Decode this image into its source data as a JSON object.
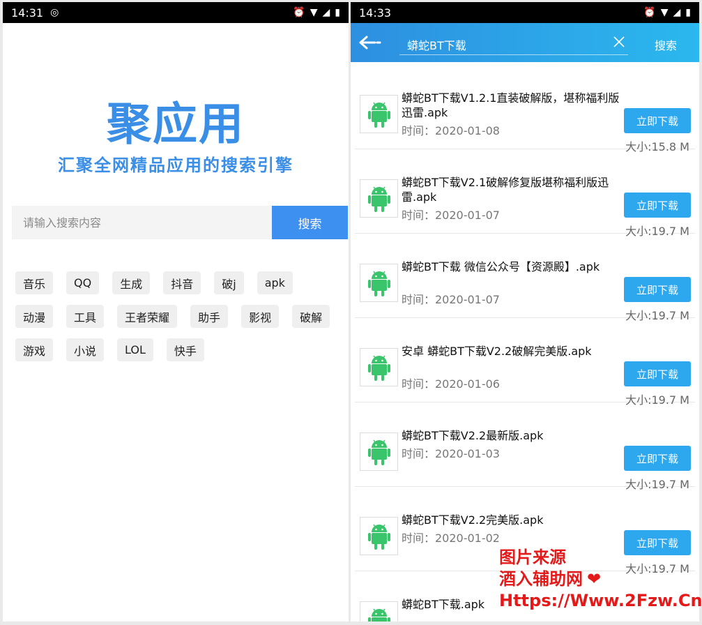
{
  "left": {
    "status": {
      "time": "14:31"
    },
    "logo": {
      "title": "聚应用",
      "subtitle": "汇聚全网精品应用的搜索引擎"
    },
    "search": {
      "placeholder": "请输入搜索内容",
      "button": "搜索"
    },
    "tags": [
      "音乐",
      "QQ",
      "生成",
      "抖音",
      "破j",
      "apk",
      "动漫",
      "工具",
      "王者荣耀",
      "助手",
      "影视",
      "破解",
      "游戏",
      "小说",
      "LOL",
      "快手"
    ]
  },
  "right": {
    "status": {
      "time": "14:33"
    },
    "topbar": {
      "query": "蟒蛇BT下载",
      "search_label": "搜索"
    },
    "results": [
      {
        "title": "蟒蛇BT下载V1.2.1直装破解版，堪称福利版迅雷.apk",
        "date": "时间：2020-01-08",
        "download": "立即下载",
        "size": "大小:15.8 M"
      },
      {
        "title": "蟒蛇BT下载V2.1破解修复版堪称福利版迅雷.apk",
        "date": "时间：2020-01-07",
        "download": "立即下载",
        "size": "大小:19.7 M"
      },
      {
        "title": "蟒蛇BT下载 微信公众号【资源殿】.apk",
        "date": "时间：2020-01-07",
        "download": "立即下载",
        "size": "大小:19.7 M"
      },
      {
        "title": "安卓 蟒蛇BT下载V2.2破解完美版.apk",
        "date": "时间：2020-01-06",
        "download": "立即下载",
        "size": "大小:19.7 M"
      },
      {
        "title": "蟒蛇BT下载V2.2最新版.apk",
        "date": "时间：2020-01-03",
        "download": "立即下载",
        "size": "大小:19.7 M"
      },
      {
        "title": "蟒蛇BT下载V2.2完美版.apk",
        "date": "时间：2020-01-02",
        "download": "立即下载",
        "size": "大小:19.7 M"
      },
      {
        "title": "蟒蛇BT下载.apk",
        "date": "",
        "download": "",
        "size": ""
      }
    ]
  },
  "watermark": {
    "line1": "图片来源",
    "line2": "酒入辅助网",
    "line3": "Https://Www.2Fzw.Cn"
  },
  "colors": {
    "brand": "#3a8ee6",
    "topbar": "#2d8fe0",
    "download_button": "#2da7ee",
    "android_green": "#3ac46b",
    "watermark": "#e41a1a"
  }
}
